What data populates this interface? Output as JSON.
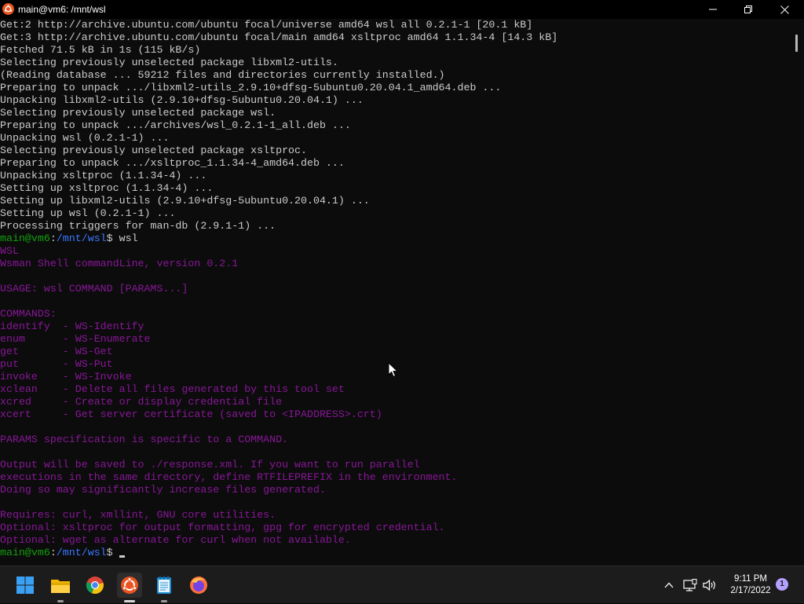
{
  "window": {
    "title": "main@vm6: /mnt/wsl",
    "controls": [
      "minimize-icon",
      "restore-icon",
      "close-icon"
    ]
  },
  "terminal": {
    "output": [
      {
        "t": "Get:2 http://archive.ubuntu.com/ubuntu focal/universe amd64 wsl all 0.2.1-1 [20.1 kB]",
        "c": "plain"
      },
      {
        "t": "Get:3 http://archive.ubuntu.com/ubuntu focal/main amd64 xsltproc amd64 1.1.34-4 [14.3 kB]",
        "c": "plain"
      },
      {
        "t": "Fetched 71.5 kB in 1s (115 kB/s)",
        "c": "plain"
      },
      {
        "t": "Selecting previously unselected package libxml2-utils.",
        "c": "plain"
      },
      {
        "t": "(Reading database ... 59212 files and directories currently installed.)",
        "c": "plain"
      },
      {
        "t": "Preparing to unpack .../libxml2-utils_2.9.10+dfsg-5ubuntu0.20.04.1_amd64.deb ...",
        "c": "plain"
      },
      {
        "t": "Unpacking libxml2-utils (2.9.10+dfsg-5ubuntu0.20.04.1) ...",
        "c": "plain"
      },
      {
        "t": "Selecting previously unselected package wsl.",
        "c": "plain"
      },
      {
        "t": "Preparing to unpack .../archives/wsl_0.2.1-1_all.deb ...",
        "c": "plain"
      },
      {
        "t": "Unpacking wsl (0.2.1-1) ...",
        "c": "plain"
      },
      {
        "t": "Selecting previously unselected package xsltproc.",
        "c": "plain"
      },
      {
        "t": "Preparing to unpack .../xsltproc_1.1.34-4_amd64.deb ...",
        "c": "plain"
      },
      {
        "t": "Unpacking xsltproc (1.1.34-4) ...",
        "c": "plain"
      },
      {
        "t": "Setting up xsltproc (1.1.34-4) ...",
        "c": "plain"
      },
      {
        "t": "Setting up libxml2-utils (2.9.10+dfsg-5ubuntu0.20.04.1) ...",
        "c": "plain"
      },
      {
        "t": "Setting up wsl (0.2.1-1) ...",
        "c": "plain"
      },
      {
        "t": "Processing triggers for man-db (2.9.1-1) ...",
        "c": "plain"
      },
      {
        "prompt": true,
        "cmd": "wsl"
      },
      {
        "t": "WSL",
        "c": "magenta"
      },
      {
        "t": "Wsman Shell commandLine, version 0.2.1",
        "c": "magenta"
      },
      {
        "t": "",
        "c": "magenta"
      },
      {
        "t": "USAGE: wsl COMMAND [PARAMS...]",
        "c": "magenta"
      },
      {
        "t": "",
        "c": "magenta"
      },
      {
        "t": "COMMANDS:",
        "c": "magenta"
      },
      {
        "t": "identify  - WS-Identify",
        "c": "magenta"
      },
      {
        "t": "enum      - WS-Enumerate",
        "c": "magenta"
      },
      {
        "t": "get       - WS-Get",
        "c": "magenta"
      },
      {
        "t": "put       - WS-Put",
        "c": "magenta"
      },
      {
        "t": "invoke    - WS-Invoke",
        "c": "magenta"
      },
      {
        "t": "xclean    - Delete all files generated by this tool set",
        "c": "magenta"
      },
      {
        "t": "xcred     - Create or display credential file",
        "c": "magenta"
      },
      {
        "t": "xcert     - Get server certificate (saved to <IPADDRESS>.crt)",
        "c": "magenta"
      },
      {
        "t": "",
        "c": "magenta"
      },
      {
        "t": "PARAMS specification is specific to a COMMAND.",
        "c": "magenta"
      },
      {
        "t": "",
        "c": "magenta"
      },
      {
        "t": "Output will be saved to ./response.xml. If you want to run parallel",
        "c": "magenta"
      },
      {
        "t": "executions in the same directory, define RTFILEPREFIX in the environment.",
        "c": "magenta"
      },
      {
        "t": "Doing so may significantly increase files generated.",
        "c": "magenta"
      },
      {
        "t": "",
        "c": "magenta"
      },
      {
        "t": "Requires: curl, xmllint, GNU core utilities.",
        "c": "magenta"
      },
      {
        "t": "Optional: xsltproc for output formatting, gpg for encrypted credential.",
        "c": "magenta"
      },
      {
        "t": "Optional: wget as alternate for curl when not available.",
        "c": "magenta"
      },
      {
        "prompt": true,
        "cmd": "",
        "cursor": true
      }
    ],
    "prompt": {
      "user_host": "main@vm6",
      "sep": ":",
      "path": "/mnt/wsl",
      "sigil": "$ "
    },
    "colors": {
      "foreground": "#cccccc",
      "background": "#0c0c0c",
      "magenta": "#881798",
      "prompt_user": "#13a10e",
      "prompt_path": "#3b78ff"
    }
  },
  "taskbar": {
    "apps": [
      "windows-start-icon",
      "file-explorer-icon",
      "chrome-icon",
      "ubuntu-terminal-icon",
      "notepad-icon",
      "firefox-icon"
    ],
    "tray": [
      "chevron-up-icon",
      "network-icon",
      "volume-icon"
    ],
    "time": "9:11 PM",
    "date": "2/17/2022",
    "notifications": "1"
  }
}
